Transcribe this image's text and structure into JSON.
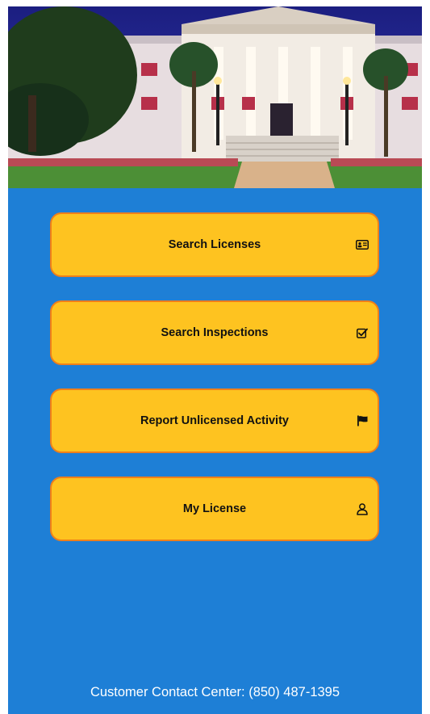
{
  "colors": {
    "background": "#1e7fd6",
    "button_fill": "#fec320",
    "button_border": "#ef7f1a",
    "button_text": "#111111",
    "footer_text": "#ffffff"
  },
  "hero": {
    "image": "capitol-building-photo"
  },
  "menu": {
    "items": [
      {
        "label": "Search Licenses",
        "icon": "id-card-icon"
      },
      {
        "label": "Search Inspections",
        "icon": "checkbox-check-icon"
      },
      {
        "label": "Report Unlicensed Activity",
        "icon": "flag-icon"
      },
      {
        "label": "My License",
        "icon": "user-icon"
      }
    ]
  },
  "footer": {
    "contact": "Customer Contact Center: (850) 487-1395"
  }
}
